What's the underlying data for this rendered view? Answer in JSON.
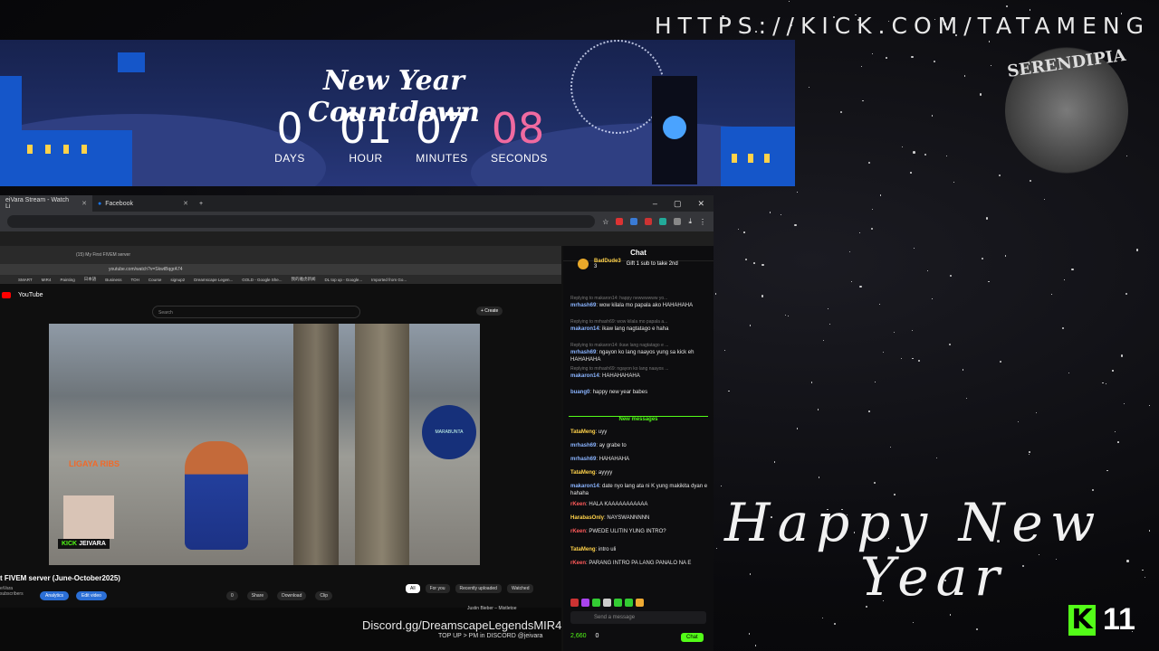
{
  "top_url": "HTTPS://KICK.COM/TATAMENG",
  "countdown": {
    "title": "New Year Countdown",
    "days": "0",
    "days_label": "DAYS",
    "hour": "01",
    "hour_label": "HOUR",
    "minutes": "07",
    "minutes_label": "MINUTES",
    "seconds": "08",
    "seconds_label": "SECONDS"
  },
  "logo_text": "SERENDIPIA",
  "greeting": {
    "line1": "Happy New",
    "line2": "Year"
  },
  "kick_badge": {
    "letter": "K",
    "count": "11"
  },
  "browser": {
    "tabs": [
      {
        "label": "eiVara Stream - Watch Li"
      },
      {
        "label": "Facebook"
      }
    ]
  },
  "inner": {
    "tab_label": "(15) My First FIVEM server",
    "address": "youtube.com/watch?v=SkwtBqgrA74",
    "bookmarks": [
      "SMART",
      "MIR4",
      "Painting",
      "日本語",
      "Business",
      "TOH",
      "Course",
      "signup2",
      "Dreamscape Legen...",
      "GOLD - Google She...",
      "我的雅虎新闻",
      "DL top up - Google...",
      "Imported from Go..."
    ],
    "yt_brand": "YouTube",
    "search_placeholder": "Search",
    "create_label": "+ Create",
    "video_title": "t FIVEM server (June-October2025)",
    "channel": "eiVara",
    "subs": "subscribers",
    "analytics": "Analytics",
    "edit_video": "Edit video",
    "actions": [
      "0",
      "Share",
      "Download",
      "Clip"
    ],
    "chips": [
      "All",
      "For you",
      "Recently uploaded",
      "Watched"
    ],
    "legaya": "LIGAYA RIBS",
    "kick_label_k": "KICK",
    "kick_label_name": "JEIVARA",
    "marabunta": "MARABUNTA",
    "discord": "Discord.gg/DreamscapeLegendsMIR4",
    "topup": "TOP UP > PM in DISCORD @jeivara",
    "now_playing": "Justin Bieber – Mistletoe"
  },
  "chat": {
    "title": "Chat",
    "gift_user": "BadDude3",
    "gift_count": "3",
    "gift_text": "Gift 1 sub to take 2nd",
    "messages": [
      {
        "reply": "Replying to makaron14: happy newwwwww yo...",
        "user": "mrhash69",
        "text": "wow kilala mo papala ako HAHAHAHA",
        "color": "#8ab4ff"
      },
      {
        "reply": "Replying to mrhash69: wow kilala mo papala a...",
        "user": "makaron14",
        "text": "ikaw lang nagtatago e haha",
        "color": "#8ab4ff"
      },
      {
        "reply": "Replying to makaron14: ikaw lang nagtatago e ...",
        "user": "mrhash69",
        "text": "ngayon ko lang naayos yung sa kick eh HAHAHAHA",
        "color": "#8ab4ff"
      },
      {
        "reply": "Replying to mrhash69: ngayon ko lang naayos ...",
        "user": "makaron14",
        "text": "HAHAHAHAHA",
        "color": "#8ab4ff"
      },
      {
        "reply": "",
        "user": "buang0",
        "text": "happy new year babes",
        "color": "#8ab4ff"
      }
    ],
    "new_messages": "New messages",
    "new": [
      {
        "user": "TataMeng",
        "text": "uyy",
        "color": "#ffd24a"
      },
      {
        "user": "mrhash69",
        "text": "ay grabe to",
        "color": "#8ab4ff"
      },
      {
        "user": "mrhash69",
        "text": "HAHAHAHA",
        "color": "#8ab4ff"
      },
      {
        "user": "TataMeng",
        "text": "ayyyy",
        "color": "#ffd24a"
      },
      {
        "user": "makaron14",
        "text": "date nyo lang ata ni K yung makikita dyan e hahaha",
        "color": "#8ab4ff"
      },
      {
        "user": "rKeen",
        "text": "HALA KAAAAAAAAAAA",
        "color": "#ff5a5a"
      },
      {
        "user": "HarabasOnly",
        "text": "NAYSWANNNNN",
        "color": "#ffd24a"
      },
      {
        "user": "rKeen",
        "text": "PWEDE ULITIN YUNG INTRO?",
        "color": "#ff5a5a"
      },
      {
        "user": "TataMeng",
        "text": "intro uli",
        "color": "#ffd24a"
      },
      {
        "user": "rKeen",
        "text": "PARANG INTRO PA LANG PANALO NA E",
        "color": "#ff5a5a"
      }
    ],
    "input_placeholder": "Send a message",
    "points": "2,660",
    "zero": "0",
    "send": "Chat"
  }
}
